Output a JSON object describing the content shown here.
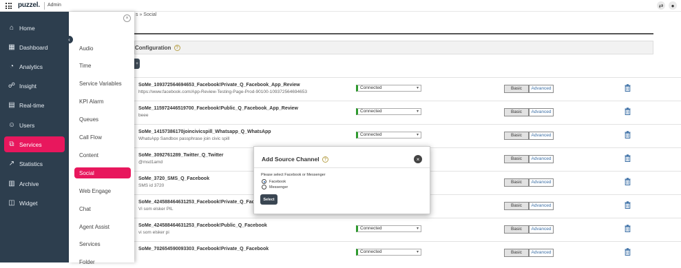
{
  "topbar": {
    "logo": "puzzel.",
    "app_label": "Admin",
    "swap_icon": "swap-icon",
    "user_icon": "user-icon"
  },
  "sidebar": {
    "items": [
      {
        "label": "Home",
        "icon": "home-icon",
        "glyph": "⌂"
      },
      {
        "label": "Dashboard",
        "icon": "dashboard-icon",
        "glyph": "▦"
      },
      {
        "label": "Analytics",
        "icon": "analytics-icon",
        "glyph": "◔"
      },
      {
        "label": "Insight",
        "icon": "insight-icon",
        "glyph": "☍"
      },
      {
        "label": "Real-time",
        "icon": "realtime-icon",
        "glyph": "▤"
      },
      {
        "label": "Users",
        "icon": "users-icon",
        "glyph": "☺"
      },
      {
        "label": "Services",
        "icon": "services-icon",
        "glyph": "⧉"
      },
      {
        "label": "Statistics",
        "icon": "statistics-icon",
        "glyph": "↗"
      },
      {
        "label": "Archive",
        "icon": "archive-icon",
        "glyph": "▥"
      },
      {
        "label": "Widget",
        "icon": "widget-icon",
        "glyph": "◫"
      }
    ],
    "active": "Services",
    "accent": "#e8175d"
  },
  "subnav": {
    "items": [
      "Audio",
      "Time",
      "Service Variables",
      "KPI Alarm",
      "Queues",
      "Call Flow",
      "Content",
      "Social",
      "Web Engage",
      "Chat",
      "Agent Assist",
      "Services",
      "Folder"
    ],
    "active": "Social"
  },
  "main": {
    "breadcrumb": "s » Social",
    "section_title": "Configuration",
    "add_label": "+",
    "rows": [
      {
        "name": "SoMe_109372564694653_Facebook!Private_Q_Facebook_App_Review",
        "desc": "https://www.facebook.com/App-Review-Testing-Page-Prod-90100-109372564694653",
        "status": "Connected"
      },
      {
        "name": "SoMe_115972446519700_Facebook!Public_Q_Facebook_App_Review",
        "desc": "beee",
        "status": "Connected"
      },
      {
        "name": "SoMe_14157386170joincivicspill_Whatsapp_Q_WhatsApp",
        "desc": "WhatsApp Sandbox passphrase join civic spill",
        "status": "Connected"
      },
      {
        "name": "SoMe_3092761289_Twitter_Q_Twitter",
        "desc": "@msd1amd",
        "status": "Connected"
      },
      {
        "name": "SoMe_3720_SMS_Q_Facebook",
        "desc": "SMS id 3720",
        "status": "Connected"
      },
      {
        "name": "SoMe_424588464631253_Facebook!Private_Q_Facebook",
        "desc": "Vi som elsker PIL",
        "status": "Connected"
      },
      {
        "name": "SoMe_424588464631253_Facebook!Public_Q_Facebook",
        "desc": "vi som elsker pi",
        "status": "Connected"
      },
      {
        "name": "SoMe_702654590093303_Facebook!Private_Q_Facebook",
        "desc": "",
        "status": "Connected"
      }
    ],
    "basic_label": "Basic",
    "advanced_label": "Advanced"
  },
  "modal": {
    "title": "Add Source Channel",
    "prompt": "Please select Facebook or Messenger",
    "options": [
      {
        "label": "Facebook",
        "checked": true
      },
      {
        "label": "Messenger",
        "checked": false
      }
    ],
    "select_label": "Select"
  }
}
